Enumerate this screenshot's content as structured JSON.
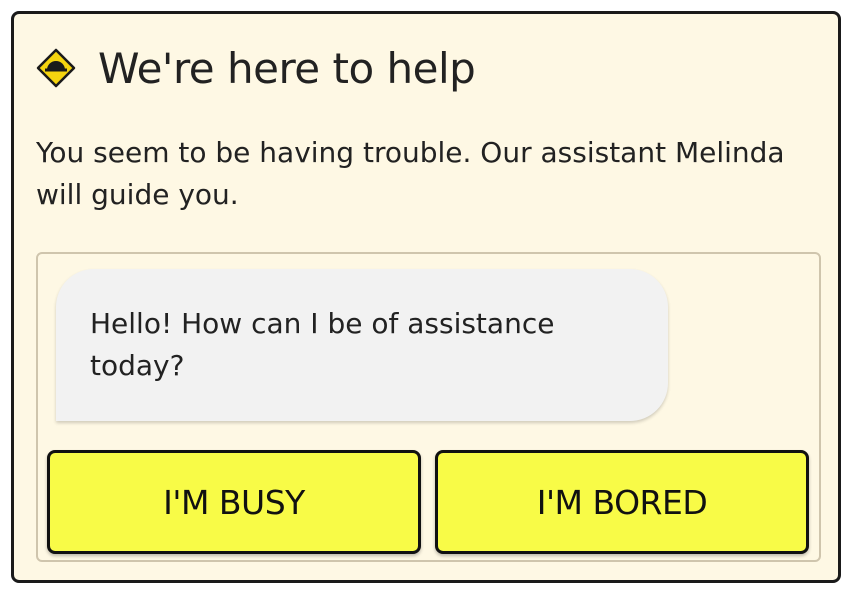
{
  "dialog": {
    "icon": "warning-diamond-icon",
    "title": "We're here to help",
    "message": "You seem to be having trouble. Our assistant Melinda will guide you."
  },
  "chat": {
    "assistant_message": "Hello! How can I be of assistance today?"
  },
  "buttons": {
    "busy_label": "I'M BUSY",
    "bored_label": "I'M BORED"
  },
  "colors": {
    "background": "#fef8e4",
    "button": "#f8fb47",
    "bubble": "#f2f2f2",
    "border": "#1a1a1a"
  }
}
